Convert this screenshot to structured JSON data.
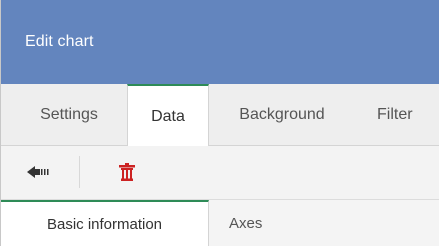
{
  "dialog": {
    "title": "Edit chart"
  },
  "tabs": [
    {
      "label": "Settings"
    },
    {
      "label": "Data",
      "active": true
    },
    {
      "label": "Background"
    },
    {
      "label": "Filter"
    }
  ],
  "toolbar": {
    "back_icon": "arrow-left-icon",
    "delete_icon": "trash-icon",
    "delete_color": "#cc2222"
  },
  "subtabs": [
    {
      "label": "Basic information",
      "active": true
    },
    {
      "label": "Axes"
    }
  ],
  "colors": {
    "header": "#6385be",
    "active_accent": "#2e8b57"
  }
}
